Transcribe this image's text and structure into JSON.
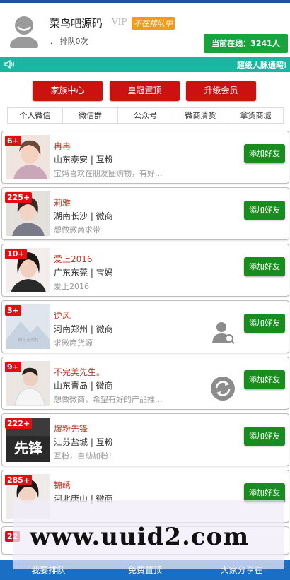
{
  "header": {
    "site_name": "菜鸟吧源码",
    "vip_label": "VIP",
    "queue_status": "不在排队中",
    "queue_count": "． 排队0次",
    "online_text": "当前在线：3241人"
  },
  "notice": {
    "text": "超级人脉通暇!"
  },
  "actions": {
    "family": "家族中心",
    "crown": "皇冠置顶",
    "upgrade": "升级会员"
  },
  "tabs": [
    "个人微信",
    "微信群",
    "公众号",
    "微商清货",
    "拿货商城"
  ],
  "list": [
    {
      "count": "6+",
      "name": "冉冉",
      "region": "山东泰安 | 互粉",
      "desc": "宝妈喜欢在朋友圈购物，有好...",
      "button": "添加好友"
    },
    {
      "count": "225+",
      "name": "莉雅",
      "region": "湖南长沙 | 微商",
      "desc": "想做微商求带",
      "button": "添加好友"
    },
    {
      "count": "10+",
      "name": "爱上2016",
      "region": "广东东莞 | 宝妈",
      "desc": "爱上2016",
      "button": "添加好友"
    },
    {
      "count": "3+",
      "name": "逆风",
      "region": "河南郑州 | 微商",
      "desc": "求微商货源",
      "button": "添加好友",
      "thumb_text": "晒可无图片"
    },
    {
      "count": "9+",
      "name": "不完美先生。",
      "region": "山东青岛 | 微商",
      "desc": "想做微商，希望有好的产品推...",
      "button": "添加好友"
    },
    {
      "count": "222+",
      "name": "爆粉先锋",
      "region": "江苏盐城 | 互粉",
      "desc": "互粉，自动加粉！",
      "button": "添加好友",
      "thumb_text": "先锋"
    },
    {
      "count": "285+",
      "name": "锦绣",
      "region": "河北唐山 | 微商",
      "desc": "",
      "button": "添加好友"
    },
    {
      "count": "22",
      "name": "",
      "region": "",
      "desc": "",
      "button": ""
    }
  ],
  "bottom_nav": [
    "我要排队",
    "免费置顶",
    "大家分享在"
  ],
  "watermark": "www.uuid2.com",
  "colors": {
    "accent_green": "#17a53a",
    "accent_red": "#cc1111",
    "notice_teal": "#19b6a2",
    "nav_blue": "#1a6fc4"
  }
}
